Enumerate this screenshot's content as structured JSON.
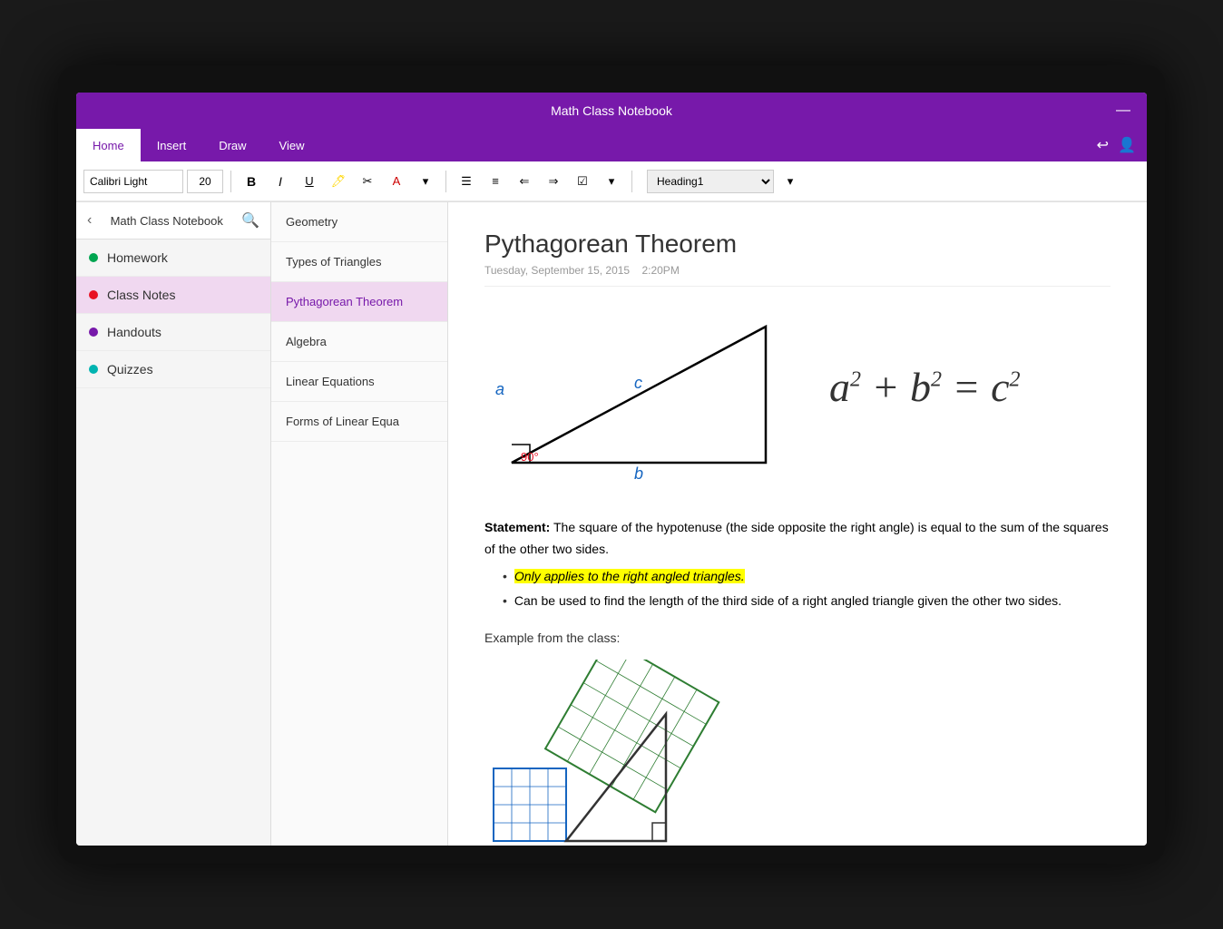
{
  "titleBar": {
    "title": "Math Class Notebook",
    "minimizeBtn": "—",
    "closeBtn": "✕"
  },
  "ribbon": {
    "tabs": [
      {
        "label": "Home",
        "active": true
      },
      {
        "label": "Insert",
        "active": false
      },
      {
        "label": "Draw",
        "active": false
      },
      {
        "label": "View",
        "active": false
      }
    ],
    "fontName": "Calibri Light",
    "fontSize": "20",
    "headingValue": "Heading1",
    "undoLabel": "↩",
    "userLabel": "👤"
  },
  "sidebar": {
    "notebookTitle": "Math Class Notebook",
    "sections": [
      {
        "label": "Homework",
        "color": "#00A550",
        "active": false
      },
      {
        "label": "Class Notes",
        "color": "#E81123",
        "active": true
      },
      {
        "label": "Handouts",
        "color": "#7719AA",
        "active": false
      },
      {
        "label": "Quizzes",
        "color": "#00B4B1",
        "active": false
      }
    ]
  },
  "pages": [
    {
      "label": "Geometry",
      "active": false
    },
    {
      "label": "Types of Triangles",
      "active": false
    },
    {
      "label": "Pythagorean Theorem",
      "active": true
    },
    {
      "label": "Algebra",
      "active": false
    },
    {
      "label": "Linear Equations",
      "active": false
    },
    {
      "label": "Forms of Linear Equa",
      "active": false
    }
  ],
  "note": {
    "title": "Pythagorean Theorem",
    "date": "Tuesday, September 15, 2015",
    "time": "2:20PM",
    "statementLabel": "Statement:",
    "statementText": " The square of the hypotenuse (the side opposite the right angle) is equal to the sum of the squares of the other two sides.",
    "bullet1": "Only applies to the right angled triangles.",
    "bullet2": "Can be used to find the length of the third side of a right angled triangle given the other two sides.",
    "exampleLabel": "Example from the class:"
  },
  "triangle": {
    "sideA": "a",
    "sideB": "b",
    "sideC": "c",
    "angle": "90°"
  },
  "formula": {
    "text": "a² + b² = c²"
  }
}
